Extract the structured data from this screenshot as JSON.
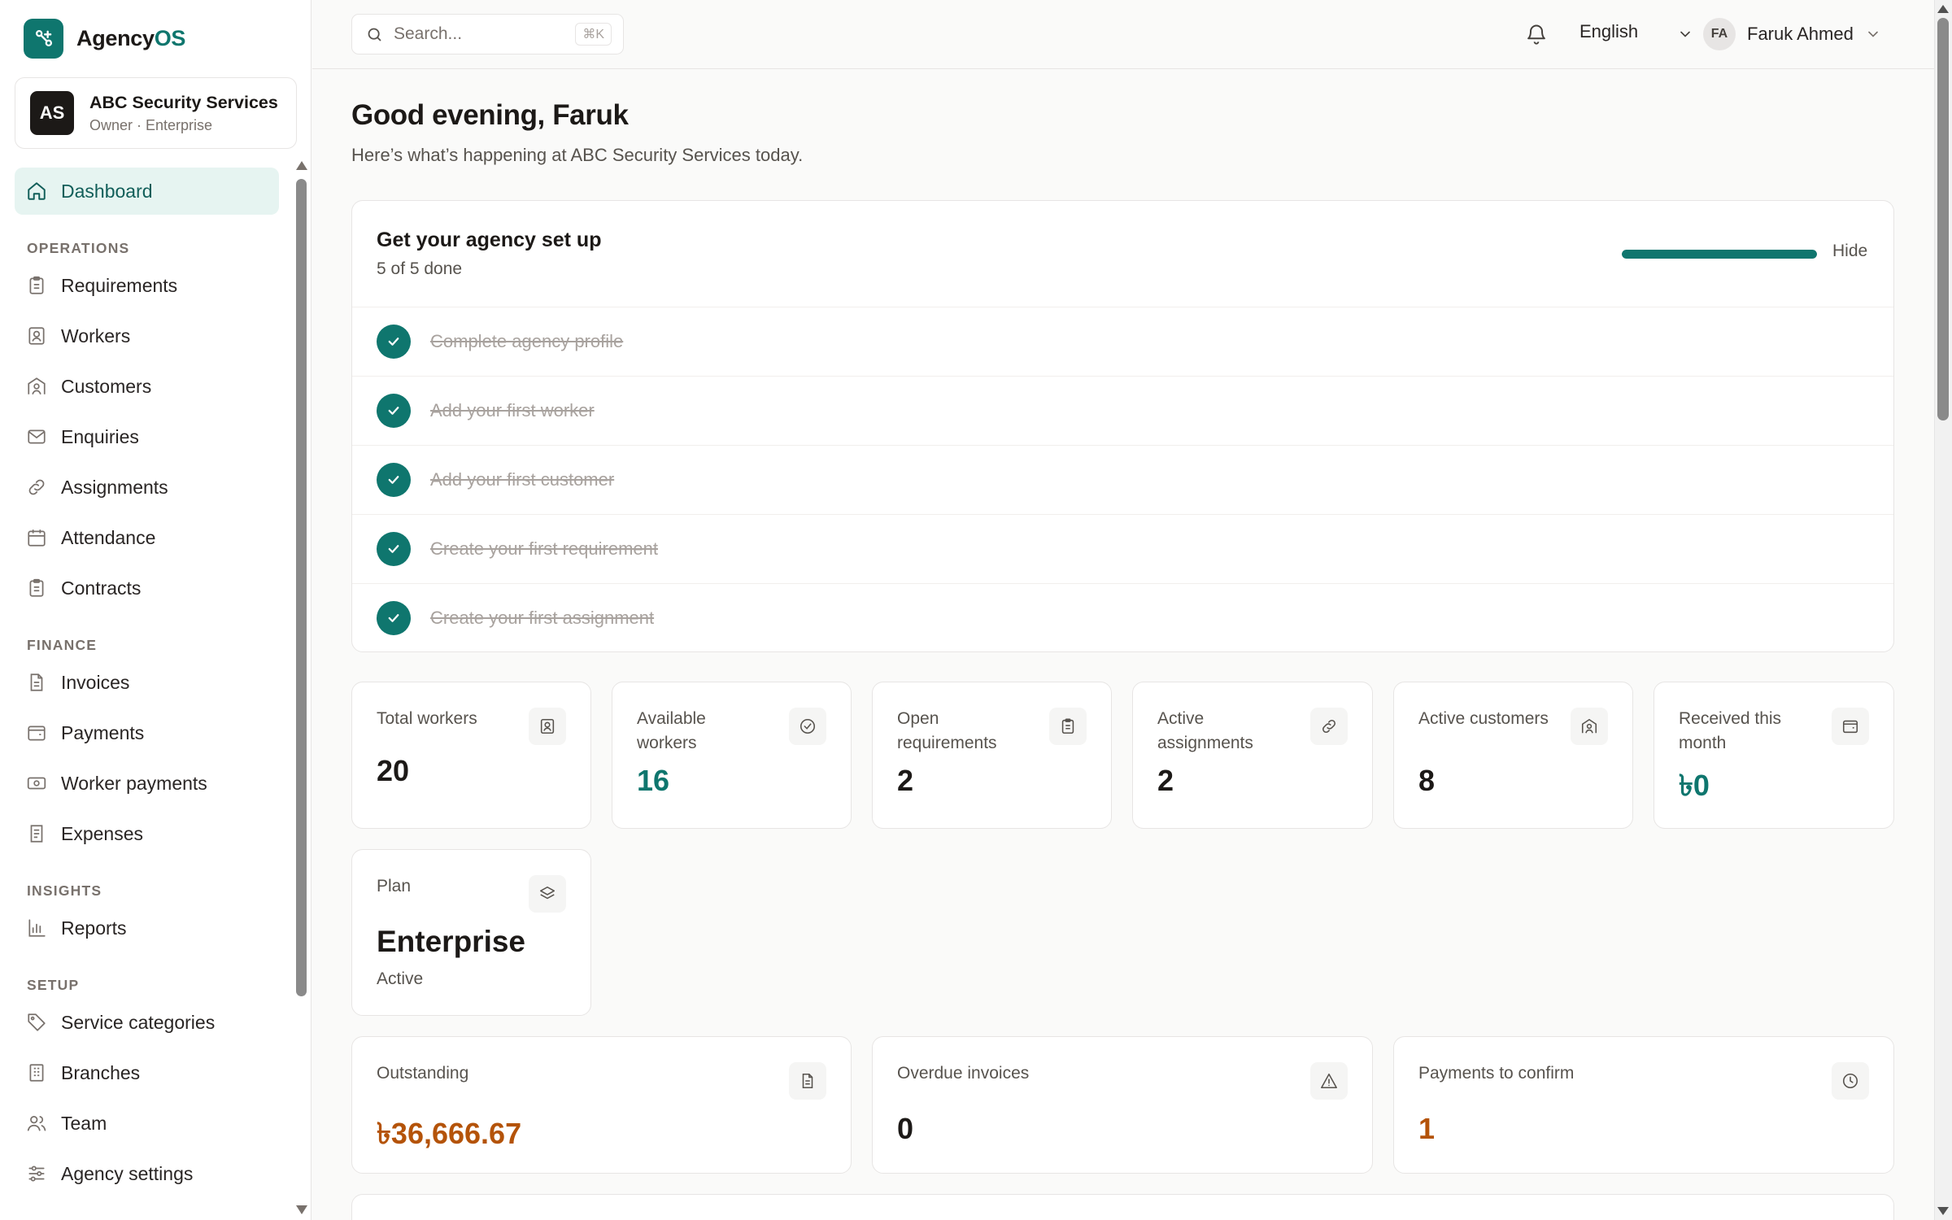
{
  "brand": {
    "name_main": "Agency",
    "name_accent": "OS",
    "accent_color": "#0f766e"
  },
  "org": {
    "initials": "AS",
    "name": "ABC Security Services",
    "subtitle": "Owner · Enterprise"
  },
  "sidebar": {
    "dashboard": "Dashboard",
    "sections": {
      "operations": "OPERATIONS",
      "finance": "FINANCE",
      "insights": "INSIGHTS",
      "setup": "SETUP"
    },
    "operations": [
      {
        "label": "Requirements",
        "icon": "clipboard-icon"
      },
      {
        "label": "Workers",
        "icon": "id-badge-icon"
      },
      {
        "label": "Customers",
        "icon": "building-user-icon"
      },
      {
        "label": "Enquiries",
        "icon": "mail-icon"
      },
      {
        "label": "Assignments",
        "icon": "link-icon"
      },
      {
        "label": "Attendance",
        "icon": "calendar-icon"
      },
      {
        "label": "Contracts",
        "icon": "clipboard-icon"
      }
    ],
    "finance": [
      {
        "label": "Invoices",
        "icon": "document-icon"
      },
      {
        "label": "Payments",
        "icon": "wallet-icon"
      },
      {
        "label": "Worker payments",
        "icon": "banknote-icon"
      },
      {
        "label": "Expenses",
        "icon": "receipt-icon"
      }
    ],
    "insights": [
      {
        "label": "Reports",
        "icon": "bar-chart-icon"
      }
    ],
    "setup": [
      {
        "label": "Service categories",
        "icon": "tag-icon"
      },
      {
        "label": "Branches",
        "icon": "building-icon"
      },
      {
        "label": "Team",
        "icon": "users-icon"
      },
      {
        "label": "Agency settings",
        "icon": "sliders-icon"
      }
    ]
  },
  "topbar": {
    "search_placeholder": "Search...",
    "search_shortcut": "⌘K",
    "language": "English",
    "user_initials": "FA",
    "user_name": "Faruk Ahmed"
  },
  "greeting": {
    "title": "Good evening, Faruk",
    "subtitle": "Here’s what’s happening at ABC Security Services today."
  },
  "setup": {
    "title": "Get your agency set up",
    "count": "5 of 5 done",
    "progress": 1.0,
    "hide": "Hide",
    "steps": [
      "Complete agency profile",
      "Add your first worker",
      "Add your first customer",
      "Create your first requirement",
      "Create your first assignment"
    ]
  },
  "stats": {
    "total_workers": {
      "label": "Total workers",
      "value": "20",
      "icon": "id-badge-icon"
    },
    "available_workers": {
      "label": "Available workers",
      "value": "16",
      "icon": "check-circle-icon"
    },
    "open_requirements": {
      "label": "Open requirements",
      "value": "2",
      "icon": "clipboard-icon"
    },
    "active_assignments": {
      "label": "Active assignments",
      "value": "2",
      "icon": "link-icon"
    },
    "active_customers": {
      "label": "Active customers",
      "value": "8",
      "icon": "building-user-icon"
    },
    "received_month": {
      "label": "Received this month",
      "value": "৳0",
      "icon": "wallet-icon"
    },
    "plan": {
      "label": "Plan",
      "value": "Enterprise",
      "sub": "Active",
      "icon": "layers-icon"
    },
    "outstanding": {
      "label": "Outstanding",
      "value": "৳36,666.67",
      "icon": "document-icon"
    },
    "overdue": {
      "label": "Overdue invoices",
      "value": "0",
      "icon": "warning-icon"
    },
    "payments_confirm": {
      "label": "Payments to confirm",
      "value": "1",
      "icon": "clock-icon"
    }
  },
  "colors": {
    "primary": "#0f766e",
    "warning": "#b45309",
    "active_bg": "#e6f4f1"
  }
}
